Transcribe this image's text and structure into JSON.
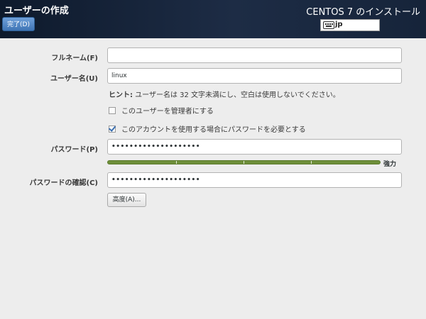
{
  "header": {
    "title": "ユーザーの作成",
    "done_label": "完了(D)",
    "product": "CENTOS 7 のインストール",
    "keyboard_layout": "jp"
  },
  "form": {
    "fullname_label": "フルネーム(F)",
    "fullname_value": "",
    "username_label": "ユーザー名(U)",
    "username_value": "linux",
    "hint_prefix": "ヒント:",
    "hint_text": " ユーザー名は 32 文字未満にし、空白は使用しないでください。",
    "admin_checkbox_label": "このユーザーを管理者にする",
    "admin_checked": false,
    "require_password_label": "このアカウントを使用する場合にパスワードを必要とする",
    "require_password_checked": true,
    "password_label": "パスワード(P)",
    "password_value": "••••••••••••••••••••",
    "strength_label": "強力",
    "strength_level": 1.0,
    "confirm_label": "パスワードの確認(C)",
    "confirm_value": "••••••••••••••••••••",
    "advanced_label": "高度(A)..."
  },
  "colors": {
    "header_bg": "#16243a",
    "done_button": "#4a7dbd",
    "strength_bar": "#6e8f3a"
  }
}
